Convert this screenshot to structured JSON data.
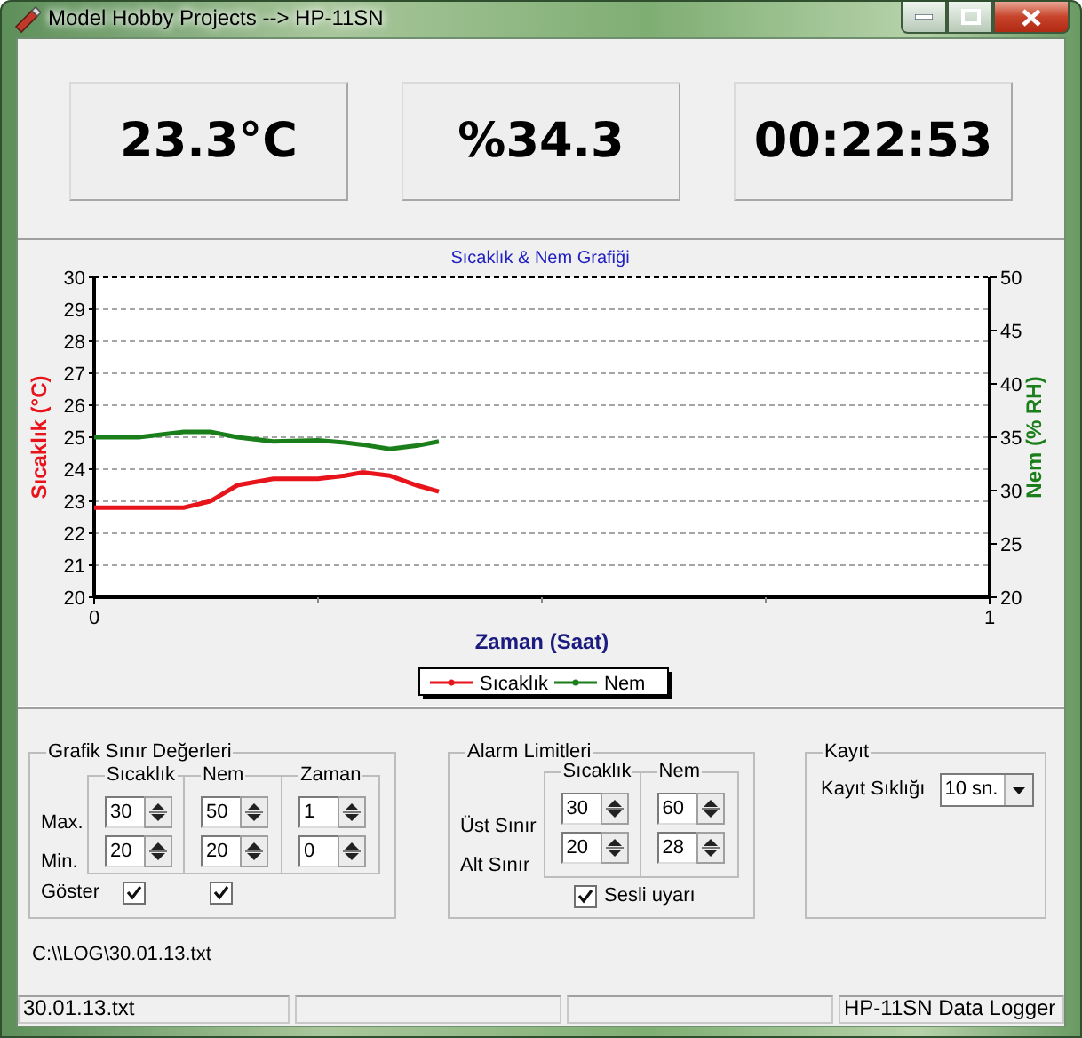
{
  "window": {
    "title": "Model Hobby Projects --> HP-11SN"
  },
  "readouts": [
    "23.3°C",
    "%34.3",
    "00:22:53"
  ],
  "chart": {
    "chart_data": {
      "type": "line",
      "title": "Sıcaklık & Nem Grafiği",
      "xlabel": "Zaman (Saat)",
      "ylabel": "Sıcaklık (°C)",
      "y2label": "Nem (% RH)",
      "x": [
        0,
        0.05,
        0.1,
        0.13,
        0.16,
        0.2,
        0.25,
        0.28,
        0.3,
        0.33,
        0.36,
        0.385
      ],
      "series": [
        {
          "name": "Sıcaklık",
          "color": "#e8141c",
          "values": [
            22.8,
            22.8,
            22.8,
            23.0,
            23.5,
            23.7,
            23.7,
            23.8,
            23.9,
            23.8,
            23.5,
            23.3
          ]
        },
        {
          "name": "Nem",
          "color": "#1a7f1a",
          "axis": "y2",
          "values": [
            35,
            35,
            35.5,
            35.5,
            35.0,
            34.6,
            34.7,
            34.5,
            34.3,
            33.9,
            34.2,
            34.6
          ]
        }
      ],
      "grid": true,
      "legend": "bottom",
      "xlim": [
        0,
        1
      ],
      "ylim": [
        20,
        30
      ],
      "y2lim": [
        20,
        50
      ],
      "xticks": [
        0,
        1
      ],
      "yticks": [
        20,
        21,
        22,
        23,
        24,
        25,
        26,
        27,
        28,
        29,
        30
      ],
      "y2ticks": [
        20,
        25,
        30,
        35,
        40,
        45,
        50
      ]
    }
  },
  "graph_limits": {
    "title": "Grafik Sınır Değerleri",
    "row_labels": [
      "Max.",
      "Min."
    ],
    "show_label": "Göster",
    "columns": [
      {
        "label": "Sıcaklık",
        "max": "30",
        "min": "20",
        "show": true
      },
      {
        "label": "Nem",
        "max": "50",
        "min": "20",
        "show": true
      },
      {
        "label": "Zaman",
        "max": "1",
        "min": "0"
      }
    ]
  },
  "alarm_limits": {
    "title": "Alarm Limitleri",
    "row_labels": [
      "Üst Sınır",
      "Alt Sınır"
    ],
    "columns": [
      {
        "label": "Sıcaklık",
        "max": "30",
        "min": "20"
      },
      {
        "label": "Nem",
        "max": "60",
        "min": "28"
      }
    ],
    "sound": {
      "label": "Sesli uyarı",
      "checked": true
    }
  },
  "record": {
    "title": "Kayıt",
    "interval_label": "Kayıt Sıklığı",
    "interval_value": "10 sn."
  },
  "file_path": "C:\\\\LOG\\30.01.13.txt",
  "status_bar": {
    "left": "30.01.13.txt",
    "right": "HP-11SN Data Logger"
  }
}
